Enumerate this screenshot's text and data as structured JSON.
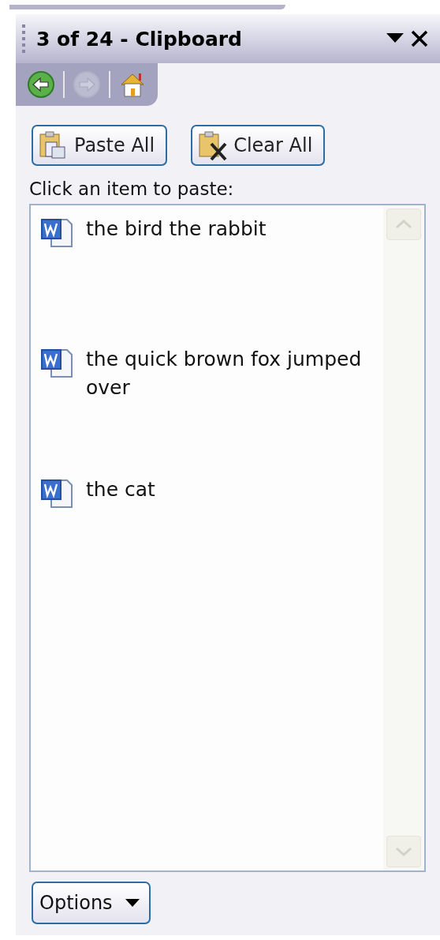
{
  "panel": {
    "title": "3 of 24 - Clipboard"
  },
  "nav": [
    {
      "kind": "back",
      "disabled": false
    },
    {
      "kind": "forward",
      "disabled": true
    },
    {
      "kind": "home",
      "disabled": false
    }
  ],
  "actions": [
    {
      "kind": "paste",
      "label": "Paste All"
    },
    {
      "kind": "clear",
      "label": "Clear All"
    }
  ],
  "instruction": "Click an item to paste:",
  "items": [
    {
      "text": "the bird the rabbit"
    },
    {
      "text": "the quick brown fox jumped over"
    },
    {
      "text": "the cat"
    }
  ],
  "options_button": {
    "label": "Options"
  }
}
